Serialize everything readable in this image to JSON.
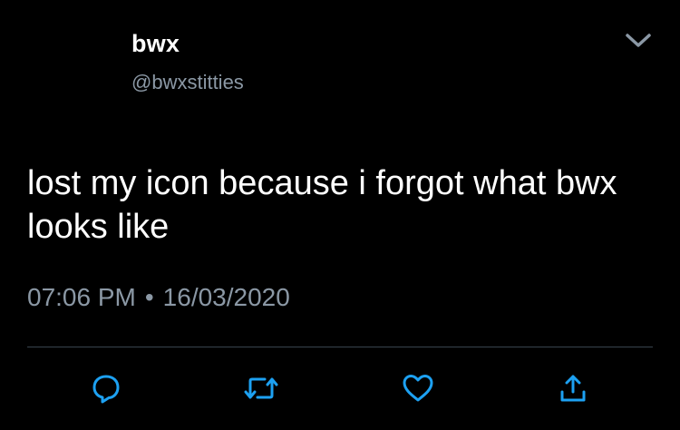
{
  "tweet": {
    "display_name": "bwx",
    "handle": "@bwxstitties",
    "text": "lost my icon because i forgot what bwx looks like",
    "time": "07:06 PM",
    "separator": "•",
    "date": "16/03/2020"
  },
  "icons": {
    "menu": "chevron-down-icon",
    "reply": "reply-icon",
    "retweet": "retweet-icon",
    "like": "heart-icon",
    "share": "share-icon"
  },
  "colors": {
    "background": "#000000",
    "primary_text": "#ffffff",
    "secondary_text": "#8b98a5",
    "icon": "#1da1f2",
    "divider": "#38444d"
  }
}
